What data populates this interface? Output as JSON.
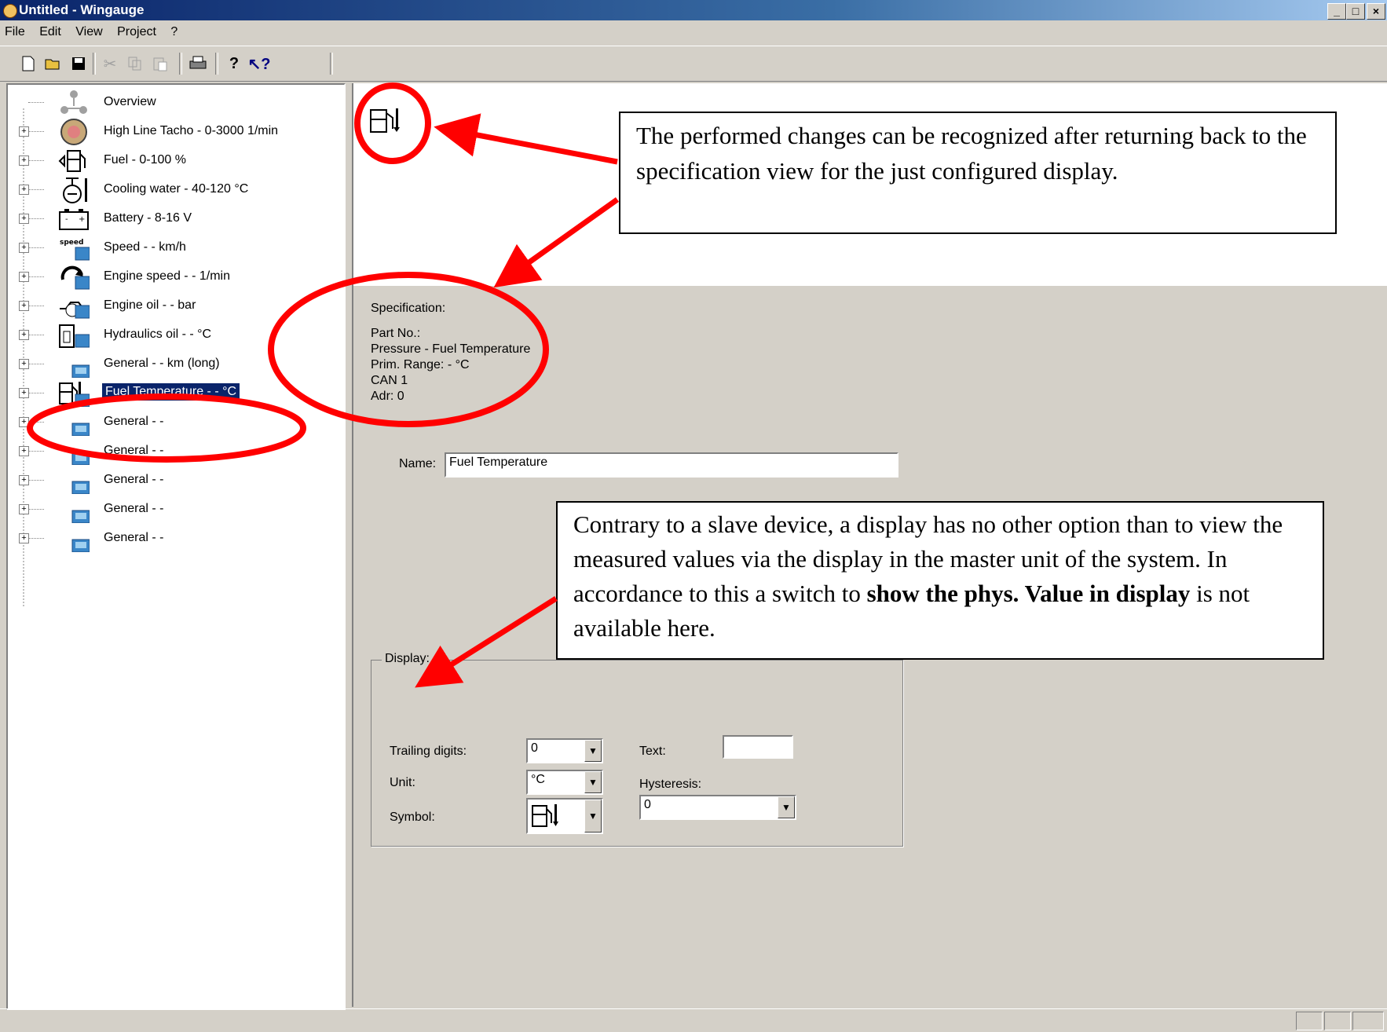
{
  "window": {
    "title": "Untitled - Wingauge",
    "min": "_",
    "max": "□",
    "close": "×"
  },
  "menu": [
    "File",
    "Edit",
    "View",
    "Project",
    "?"
  ],
  "toolbar": {
    "icons": [
      "new-icon",
      "open-icon",
      "save-icon",
      "cut-icon",
      "copy-icon",
      "paste-icon",
      "print-icon",
      "help-icon",
      "context-help-icon"
    ]
  },
  "tree": {
    "items": [
      {
        "label": "Overview",
        "icon": "overview-icon"
      },
      {
        "label": "High Line Tacho - 0-3000 1/min",
        "icon": "tacho-icon"
      },
      {
        "label": "Fuel - 0-100 %",
        "icon": "fuel-icon"
      },
      {
        "label": "Cooling water - 40-120 °C",
        "icon": "cooling-water-icon"
      },
      {
        "label": "Battery - 8-16 V",
        "icon": "battery-icon"
      },
      {
        "label": "Speed - - km/h",
        "icon": "speed-icon"
      },
      {
        "label": "Engine speed - - 1/min",
        "icon": "engine-speed-icon"
      },
      {
        "label": "Engine oil - - bar",
        "icon": "engine-oil-icon"
      },
      {
        "label": "Hydraulics oil - - °C",
        "icon": "hydraulics-oil-icon"
      },
      {
        "label": "General - - km (long)",
        "icon": "display-icon"
      },
      {
        "label": "Fuel Temperature - - °C",
        "icon": "fuel-temperature-icon",
        "selected": true
      },
      {
        "label": "General - -",
        "icon": "display-icon"
      },
      {
        "label": "General - -",
        "icon": "display-icon"
      },
      {
        "label": "General - -",
        "icon": "display-icon"
      },
      {
        "label": "General - -",
        "icon": "display-icon"
      },
      {
        "label": "General - -",
        "icon": "display-icon"
      }
    ]
  },
  "detail": {
    "specification": {
      "heading": "Specification:",
      "part_no": "Part No.:",
      "type": "Pressure - Fuel Temperature",
      "range": "Prim. Range: - °C",
      "can": "CAN 1",
      "adr": "Adr: 0"
    },
    "name_label": "Name:",
    "name_value": "Fuel Temperature",
    "display_group": "Display:",
    "trailing_digits_label": "Trailing digits:",
    "trailing_digits_value": "0",
    "unit_label": "Unit:",
    "unit_value": "°C",
    "symbol_label": "Symbol:",
    "text_label": "Text:",
    "text_value": "",
    "hysteresis_label": "Hysteresis:",
    "hysteresis_value": "0"
  },
  "callouts": {
    "top": "The performed changes can be recognized after returning back to the specification view for the just configured display.",
    "bottom_1": "Contrary to a slave device, a display has no other option than to view the measured values via the display in the master unit of the system. In accordance to this a switch to ",
    "bottom_bold": "show the phys. Value in display",
    "bottom_2": " is not available here."
  },
  "colors": {
    "annotation": "#ff0000",
    "selection": "#0a246a",
    "face": "#d4d0c8"
  }
}
